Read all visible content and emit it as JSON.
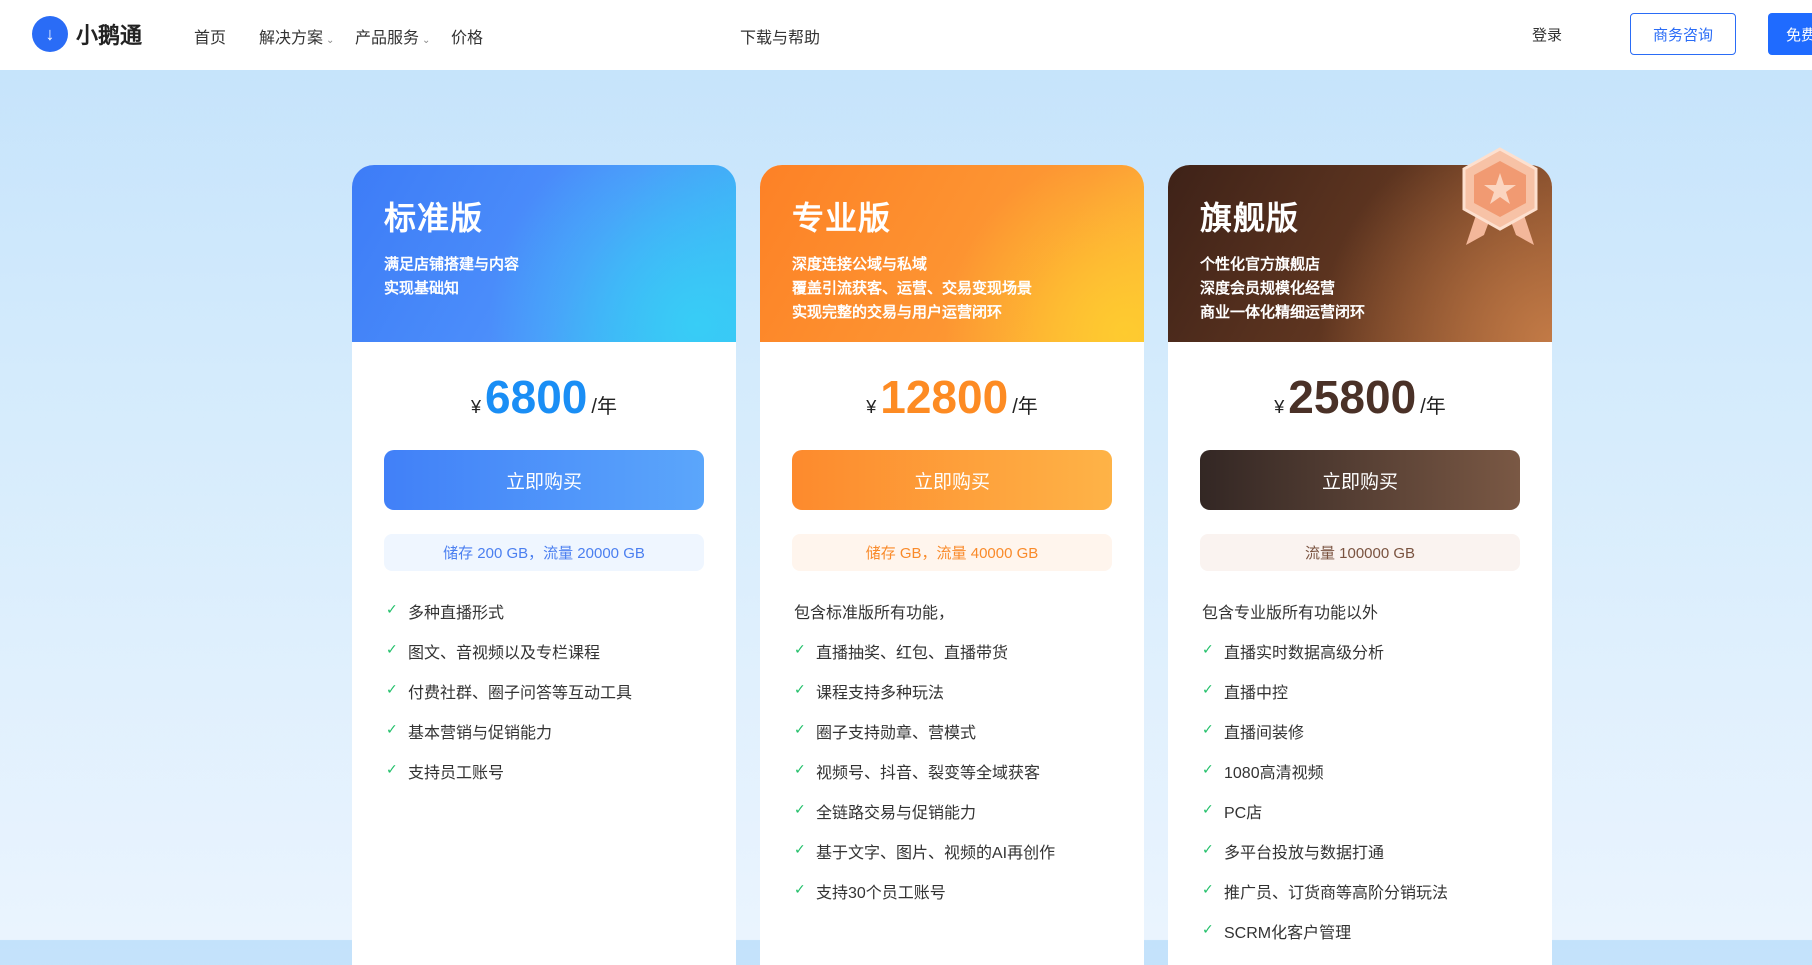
{
  "nav": {
    "logo_text": "小鹅通",
    "items": [
      {
        "label": "首页",
        "dropdown": false
      },
      {
        "label": "解决方案",
        "dropdown": true
      },
      {
        "label": "产品服务",
        "dropdown": true
      },
      {
        "label": "价格",
        "dropdown": false
      },
      {
        "label": "下载与帮助",
        "dropdown": false
      }
    ],
    "login": "登录",
    "contact_button": "商务咨询",
    "free_button": "免费"
  },
  "plans": [
    {
      "name": "标准版",
      "desc": [
        "满足店铺搭建与内容",
        "实现基础知"
      ],
      "currency": "¥",
      "price": "6800",
      "unit": "/年",
      "buy_label": "立即购买",
      "storage": "储存 200 GB，流量 20000 GB",
      "intro": "",
      "features": [
        "多种直播形式",
        "图文、音视频以及专栏课程",
        "付费社群、圈子问答等互动工具",
        "基本营销与促销能力",
        "支持员工账号"
      ],
      "accent": "#1a8ef5"
    },
    {
      "name": "专业版",
      "desc": [
        "深度连接公域与私域",
        "覆盖引流获客、运营、交易变现场景",
        "实现完整的交易与用户运营闭环"
      ],
      "currency": "¥",
      "price": "12800",
      "unit": "/年",
      "buy_label": "立即购买",
      "storage": "储存 GB，流量 40000 GB",
      "intro": "包含标准版所有功能，",
      "features": [
        "直播抽奖、红包、直播带货",
        "课程支持多种玩法",
        "圈子支持勋章、营模式",
        "视频号、抖音、裂变等全域获客",
        "全链路交易与促销能力",
        "基于文字、图片、视频的AI再创作",
        "支持30个员工账号"
      ],
      "accent": "#fd8b23"
    },
    {
      "name": "旗舰版",
      "desc": [
        "个性化官方旗舰店",
        "深度会员规模化经营",
        "商业一体化精细运营闭环"
      ],
      "currency": "¥",
      "price": "25800",
      "unit": "/年",
      "buy_label": "立即购买",
      "storage": "流量 100000 GB",
      "intro": "包含专业版所有功能以外",
      "features": [
        "直播实时数据高级分析",
        "直播中控",
        "直播间装修",
        "1080高清视频",
        "PC店",
        "多平台投放与数据打通",
        "推广员、订货商等高阶分销玩法",
        "SCRM化客户管理"
      ],
      "accent": "#4a3127"
    }
  ]
}
